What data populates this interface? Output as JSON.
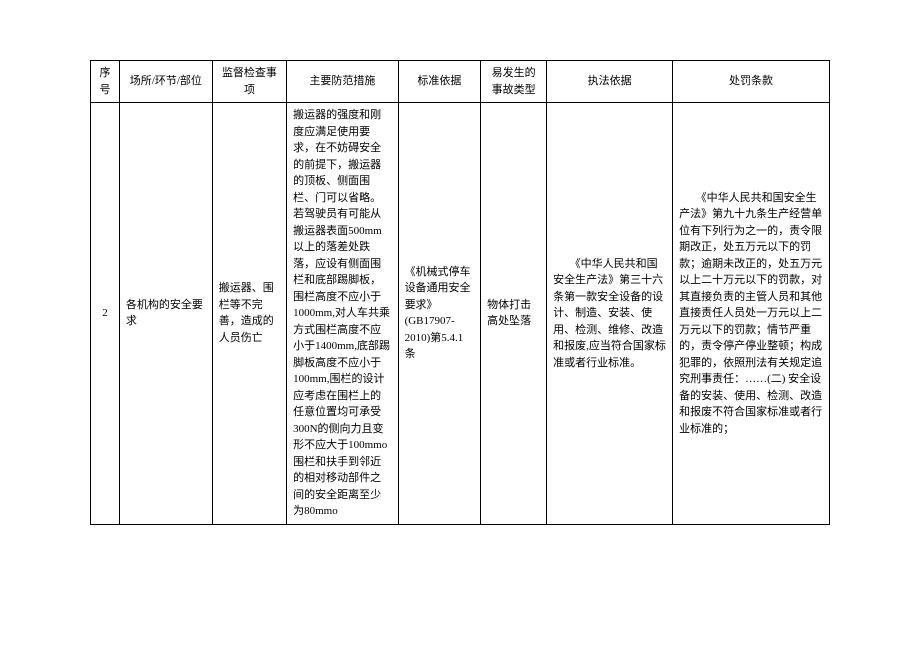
{
  "headers": {
    "c1": "序号",
    "c2": "场所/环节/部位",
    "c3": "监督检查事项",
    "c4": "主要防范措施",
    "c5": "标准依据",
    "c6": "易发生的事故类型",
    "c7": "执法依据",
    "c8": "处罚条款"
  },
  "row": {
    "seq": "2",
    "place": "各机构的安全要求",
    "inspect": "搬运器、围栏等不完善，造成的人员伤亡",
    "measures": "搬运器的强度和刚度应满足使用要求，在不妨碍安全的前提下，搬运器的顶板、侧面围栏、门可以省略。若驾驶员有可能从搬运器表面500mm以上的落差处跌落，应设有侧面围栏和底部踢脚板，围栏高度不应小于1000mm,对人车共乘方式围栏高度不应小于1400mm,底部踢脚板高度不应小于100mm,围栏的设计应考虑在围栏上的任意位置均可承受300N的侧向力且变形不应大于100mmo围栏和扶手到邻近的相对移动部件之间的安全距离至少为80mmo",
    "basis": "《机械式停车设备通用安全要求》(GB17907-2010)第5.4.1条",
    "accident": "物体打击高处坠落",
    "law": "《中华人民共和国安全生产法》第三十六条第一款安全设备的设计、制造、安装、使用、检测、维修、改造和报废,应当符合国家标准或者行业标准。",
    "penalty": "《中华人民共和国安全生产法》第九十九条生产经营单位有下列行为之一的，责令限期改正，处五万元以下的罚款；逾期未改正的，处五万元以上二十万元以下的罚款，对其直接负责的主管人员和其他直接责任人员处一万元以上二万元以下的罚款；情节严重的，责令停产停业整顿；构成犯罪的，依照刑法有关规定追究刑事责任：……(二) 安全设备的安装、使用、检测、改造和报废不符合国家标准或者行业标准的；"
  }
}
